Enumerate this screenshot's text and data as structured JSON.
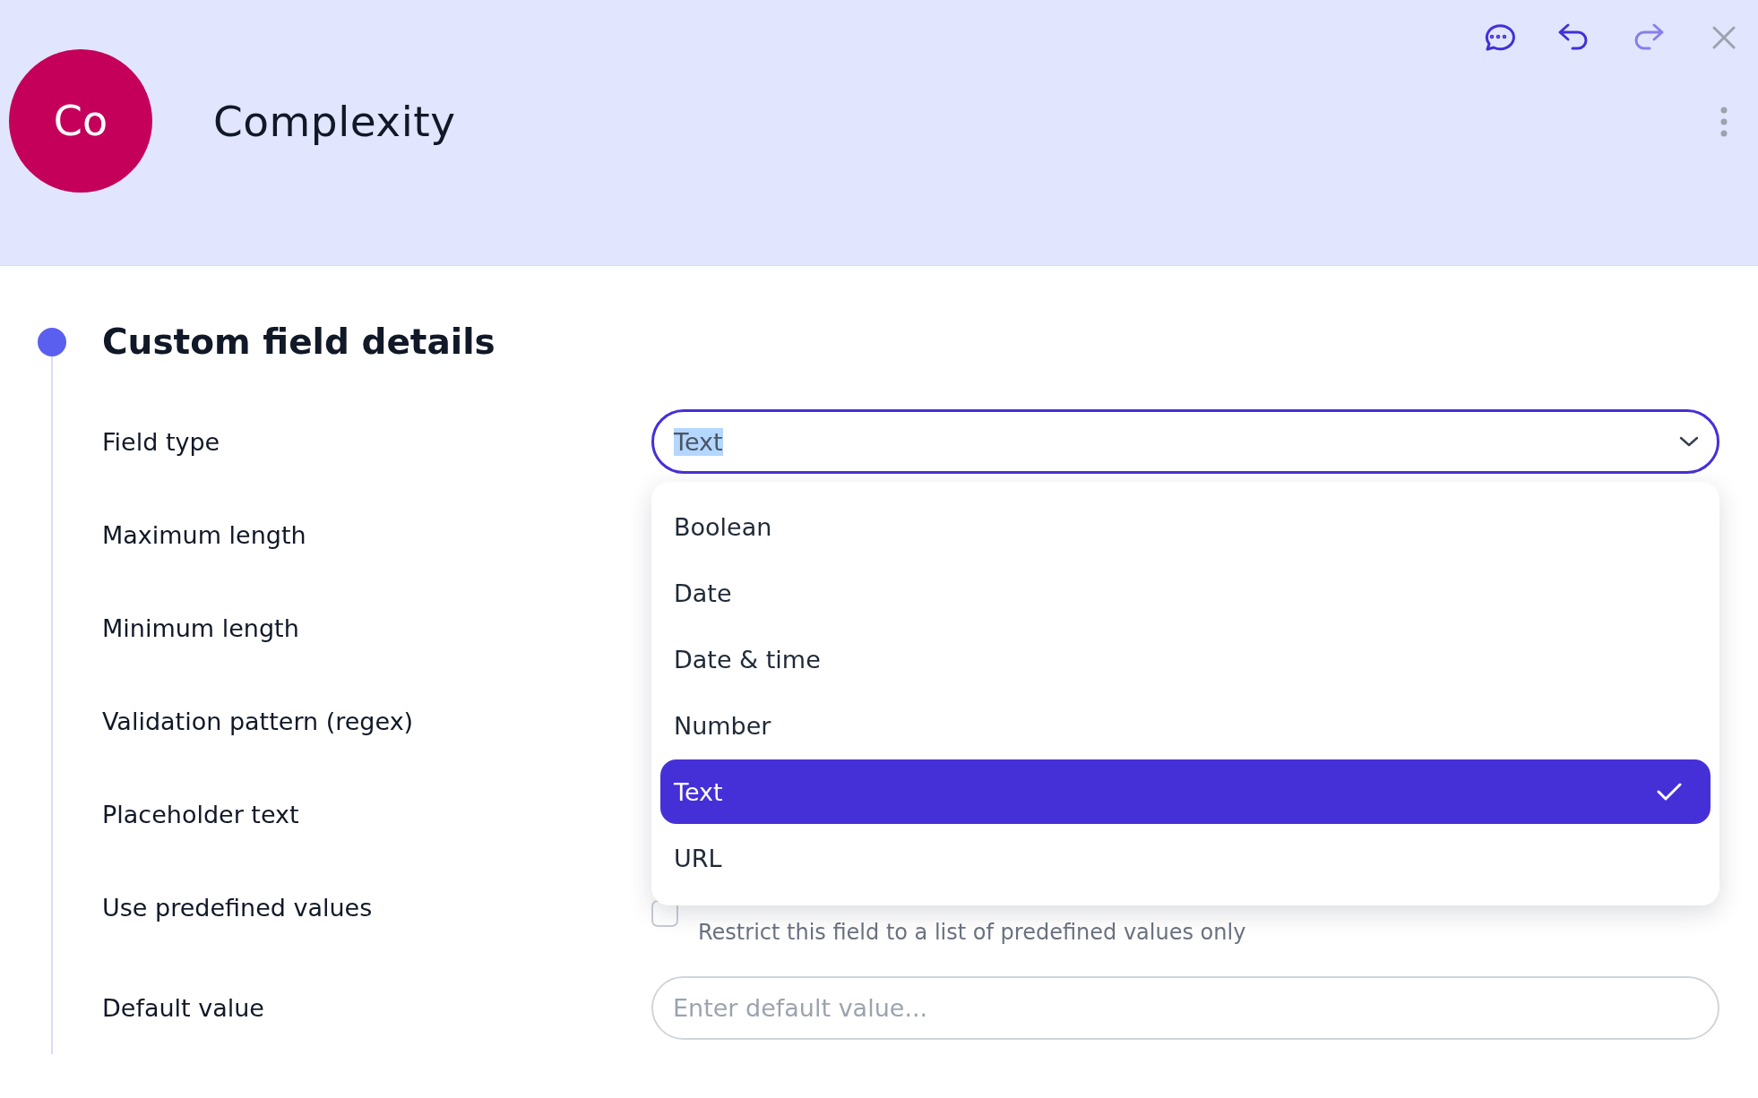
{
  "header": {
    "avatar": {
      "initials": "Co",
      "color": "#c4005a"
    },
    "title": "Complexity",
    "toolbar": [
      {
        "kind": "comment",
        "disabled": false
      },
      {
        "kind": "undo",
        "disabled": false
      },
      {
        "kind": "redo",
        "disabled": true
      },
      {
        "kind": "close",
        "disabled": false
      }
    ]
  },
  "section": {
    "title": "Custom field details",
    "rows": [
      {
        "label": "Field type",
        "kind": "select"
      },
      {
        "label": "Maximum length",
        "kind": "covered"
      },
      {
        "label": "Minimum length",
        "kind": "covered"
      },
      {
        "label": "Validation pattern (regex)",
        "kind": "covered"
      },
      {
        "label": "Placeholder text",
        "kind": "covered"
      },
      {
        "label": "Use predefined values",
        "kind": "checkbox"
      },
      {
        "label": "Default value",
        "kind": "input"
      }
    ],
    "field_type": {
      "value": "Text",
      "text_selected": true,
      "expanded": true,
      "options": [
        {
          "label": "Boolean",
          "selected": false
        },
        {
          "label": "Date",
          "selected": false
        },
        {
          "label": "Date & time",
          "selected": false
        },
        {
          "label": "Number",
          "selected": false
        },
        {
          "label": "Text",
          "selected": true
        },
        {
          "label": "URL",
          "selected": false
        }
      ]
    },
    "predefined": {
      "checked": false,
      "description": "Restrict this field to a list of predefined values only"
    },
    "default_value": {
      "placeholder": "Enter default value..."
    }
  }
}
